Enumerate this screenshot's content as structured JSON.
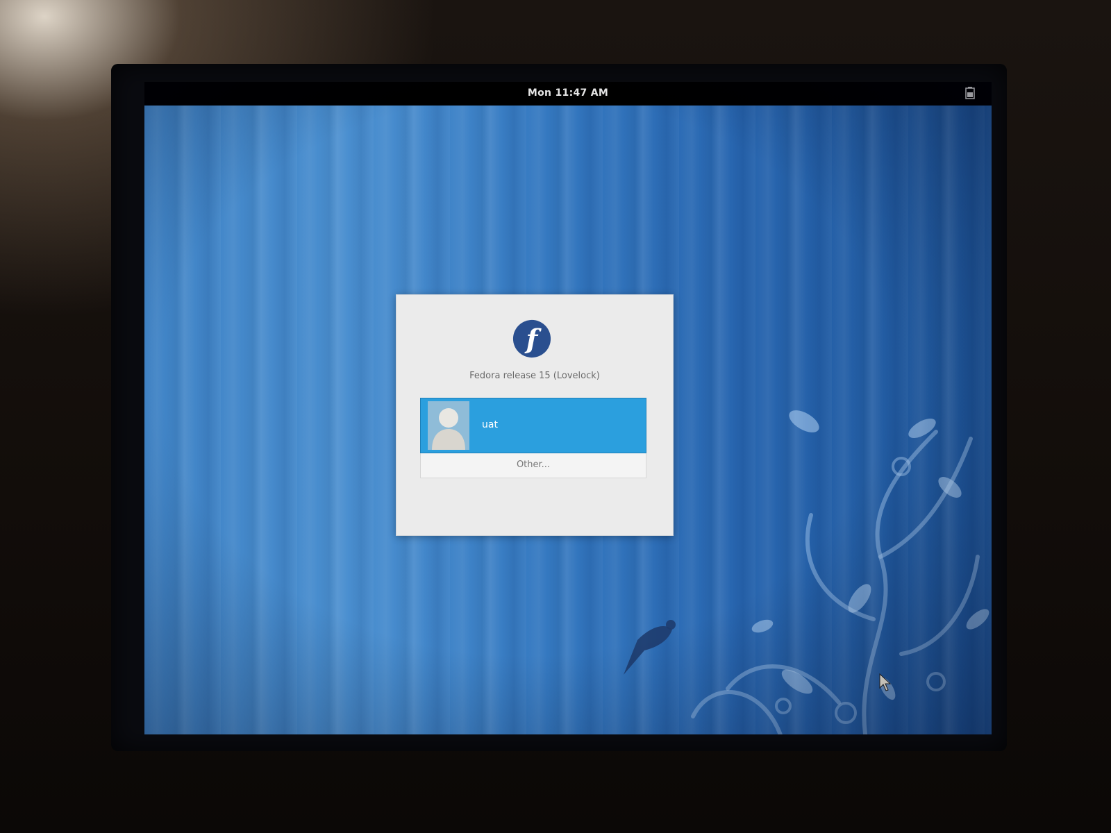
{
  "top_bar": {
    "clock": "Mon 11:47 AM",
    "status_icon": "battery-icon"
  },
  "login": {
    "logo_icon": "fedora-logo",
    "release_text": "Fedora release 15 (Lovelock)",
    "users": [
      {
        "name": "uat",
        "avatar_icon": "user-avatar-icon",
        "selected": true
      }
    ],
    "other_label": "Other..."
  },
  "colors": {
    "wallpaper_blue": "#2f72b8",
    "selection_blue": "#2b9fde",
    "dialog_bg": "#ebebeb",
    "panel_bg": "#000000"
  }
}
